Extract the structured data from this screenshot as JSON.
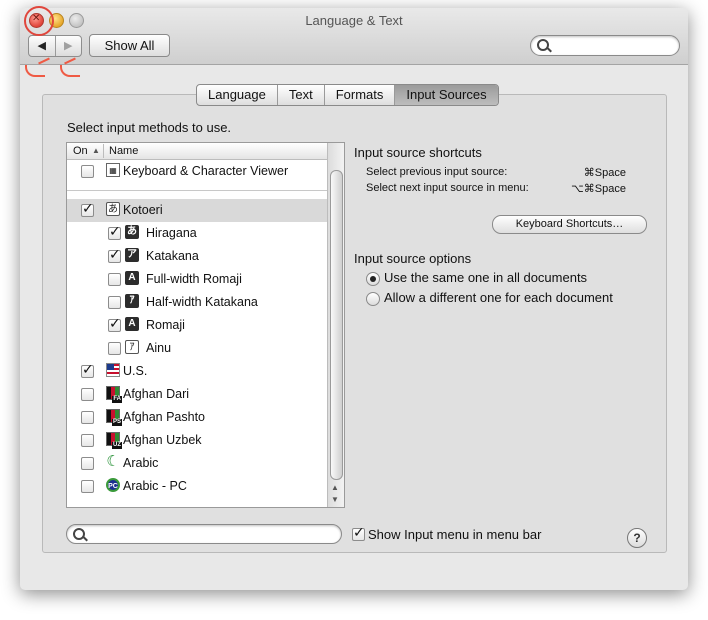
{
  "window": {
    "title": "Language & Text",
    "traffic_lights": [
      "close",
      "minimize",
      "zoom"
    ]
  },
  "toolbar": {
    "back_glyph": "◀",
    "forward_glyph": "▶",
    "show_all_label": "Show All",
    "search_placeholder": ""
  },
  "tabs": [
    {
      "label": "Language",
      "active": false
    },
    {
      "label": "Text",
      "active": false
    },
    {
      "label": "Formats",
      "active": false
    },
    {
      "label": "Input Sources",
      "active": true
    }
  ],
  "input_methods": {
    "prompt": "Select input methods to use.",
    "columns": {
      "on": "On",
      "sort_glyph": "▲",
      "name": "Name"
    },
    "items": [
      {
        "label": "Keyboard & Character Viewer",
        "checked": false,
        "indent": false,
        "icon": "keyboard-viewer-icon",
        "glyph": "▦"
      },
      {
        "label": "Kotoeri",
        "checked": true,
        "indent": false,
        "icon": "kotoeri-icon",
        "glyph": "あ",
        "selected": true
      },
      {
        "label": "Hiragana",
        "checked": true,
        "indent": true,
        "icon": "hiragana-icon",
        "glyph": "あ"
      },
      {
        "label": "Katakana",
        "checked": true,
        "indent": true,
        "icon": "katakana-icon",
        "glyph": "ア"
      },
      {
        "label": "Full-width Romaji",
        "checked": false,
        "indent": true,
        "icon": "fullwidth-romaji-icon",
        "glyph": "A"
      },
      {
        "label": "Half-width Katakana",
        "checked": false,
        "indent": true,
        "icon": "halfwidth-katakana-icon",
        "glyph": "ｱ"
      },
      {
        "label": "Romaji",
        "checked": true,
        "indent": true,
        "icon": "romaji-icon",
        "glyph": "A"
      },
      {
        "label": "Ainu",
        "checked": false,
        "indent": true,
        "icon": "ainu-icon",
        "glyph": "ｱ"
      },
      {
        "label": "U.S.",
        "checked": true,
        "indent": false,
        "icon": "us-flag-icon"
      },
      {
        "label": "Afghan Dari",
        "checked": false,
        "indent": false,
        "icon": "afghan-flag-icon",
        "sub": "FA"
      },
      {
        "label": "Afghan Pashto",
        "checked": false,
        "indent": false,
        "icon": "afghan-flag-icon",
        "sub": "PS"
      },
      {
        "label": "Afghan Uzbek",
        "checked": false,
        "indent": false,
        "icon": "afghan-flag-icon",
        "sub": "UZ"
      },
      {
        "label": "Arabic",
        "checked": false,
        "indent": false,
        "icon": "crescent-icon",
        "glyph": "☾"
      },
      {
        "label": "Arabic - PC",
        "checked": false,
        "indent": false,
        "icon": "arabic-pc-icon",
        "glyph": "PC"
      }
    ]
  },
  "shortcuts": {
    "title": "Input source shortcuts",
    "rows": [
      {
        "label": "Select previous input source:",
        "key": "⌘Space"
      },
      {
        "label": "Select next input source in menu:",
        "key": "⌥⌘Space"
      }
    ],
    "button_label": "Keyboard Shortcuts…"
  },
  "options": {
    "title": "Input source options",
    "radios": [
      {
        "label": "Use the same one in all documents",
        "selected": true
      },
      {
        "label": "Allow a different one for each document",
        "selected": false
      }
    ]
  },
  "footer": {
    "search_placeholder": "",
    "show_menu_label": "Show Input menu in menu bar",
    "show_menu_checked": true,
    "help_glyph": "?"
  },
  "colors": {
    "annotation": "#e0463c",
    "selected_row": "#d9d9d9",
    "window_bg": "#e8e8e8"
  }
}
